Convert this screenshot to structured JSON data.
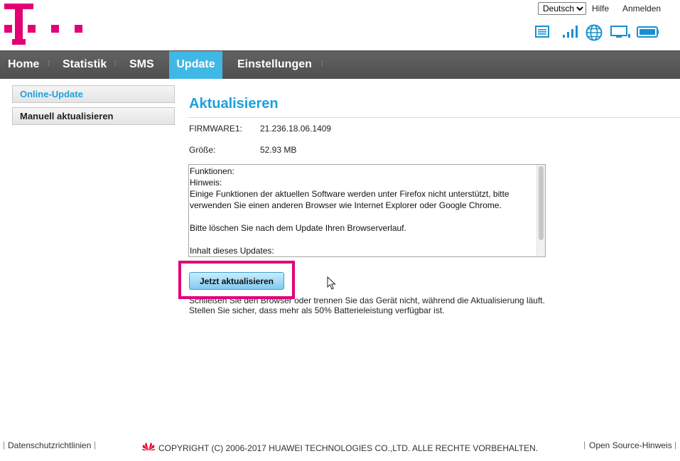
{
  "header": {
    "language": {
      "selected": "Deutsch",
      "options": [
        "Deutsch"
      ]
    },
    "help_label": "Hilfe",
    "login_label": "Anmelden",
    "brand_color": "#e20074",
    "status_icons": [
      "message-list-icon",
      "signal-strength-icon",
      "globe-internet-icon",
      "device-monitor-icon",
      "battery-icon"
    ]
  },
  "nav": {
    "items": [
      {
        "label": "Home"
      },
      {
        "label": "Statistik"
      },
      {
        "label": "SMS"
      },
      {
        "label": "Update",
        "active": true
      },
      {
        "label": "Einstellungen"
      }
    ],
    "separator": "⁞"
  },
  "sidebar": {
    "items": [
      {
        "label": "Online-Update",
        "active": true
      },
      {
        "label": "Manuell aktualisieren"
      }
    ]
  },
  "main": {
    "title": "Aktualisieren",
    "firmware_label": "FIRMWARE1:",
    "firmware_value": "21.236.18.06.1409",
    "size_label": "Größe:",
    "size_value": "52.93 MB",
    "release_notes": [
      "Funktionen:",
      "Hinweis:",
      "Einige Funktionen der aktuellen Software werden unter Firefox nicht unterstützt, bitte verwenden Sie einen anderen Browser wie Internet Explorer oder Google Chrome.",
      "",
      "Bitte löschen Sie nach dem Update Ihren Browserverlauf.",
      "",
      "Inhalt dieses Updates:"
    ],
    "update_button": "Jetzt aktualisieren",
    "note_line1": "Schließen Sie den Browser oder trennen Sie das Gerät nicht, während die Aktualisierung läuft.",
    "note_line2": "Stellen Sie sicher, dass mehr als 50% Batterieleistung verfügbar ist.",
    "accent_color": "#1ea0dc",
    "highlight_color": "#e0007a"
  },
  "footer": {
    "privacy_label": "Datenschutzrichtlinien",
    "copyright": "COPYRIGHT (C) 2006-2017 HUAWEI TECHNOLOGIES CO.,LTD. ALLE RECHTE VORBEHALTEN.",
    "open_source_label": "Open Source-Hinweis"
  }
}
